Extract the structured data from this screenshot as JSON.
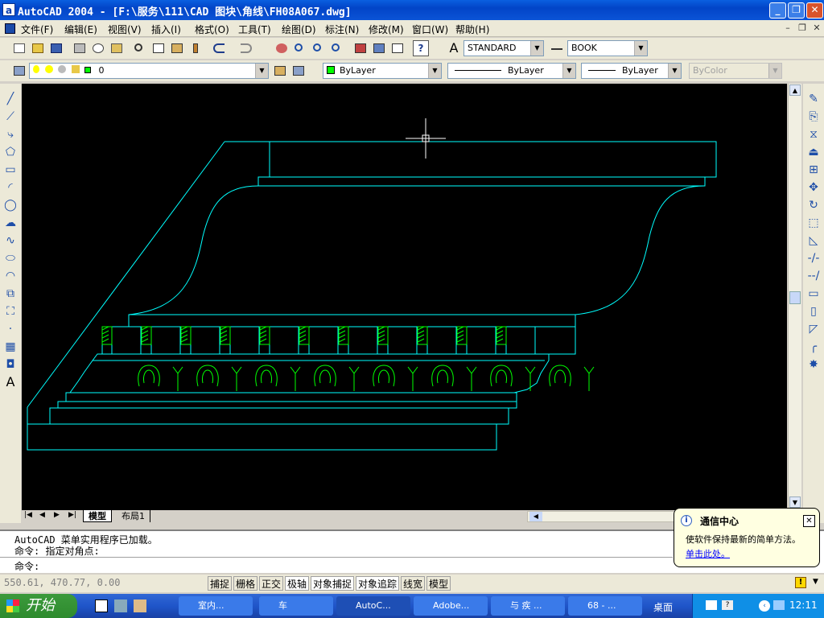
{
  "window": {
    "title": "AutoCAD 2004 - [F:\\服务\\111\\CAD 图块\\角线\\FH08A067.dwg]",
    "app_icon_letter": "a",
    "minimize_glyph": "_",
    "restore_glyph": "❐",
    "close_glyph": "✕"
  },
  "menu": {
    "items": [
      "文件(F)",
      "编辑(E)",
      "视图(V)",
      "插入(I)",
      "格式(O)",
      "工具(T)",
      "绘图(D)",
      "标注(N)",
      "修改(M)",
      "窗口(W)",
      "帮助(H)"
    ],
    "mdi_min": "–",
    "mdi_restore": "❐",
    "mdi_close": "✕"
  },
  "standard_toolbar": {
    "text_style": "STANDARD",
    "dim_style": "BOOK",
    "help_glyph": "?"
  },
  "properties_toolbar": {
    "layer": "0",
    "color": "ByLayer",
    "linetype": "ByLayer",
    "lineweight": "ByLayer",
    "plotstyle": "ByColor"
  },
  "left_toolbar": {
    "text_tool": "A"
  },
  "layout_tabs": {
    "model": "模型",
    "layout1": "布局1"
  },
  "command": {
    "line1": "AutoCAD 菜单实用程序已加载。",
    "line2": "命令: 指定对角点:",
    "prompt": "命令:"
  },
  "status": {
    "coords": "550.61, 470.77, 0.00",
    "buttons": [
      "捕捉",
      "栅格",
      "正交",
      "极轴",
      "对象捕捉",
      "对象追踪",
      "线宽",
      "模型"
    ]
  },
  "balloon": {
    "title": "通信中心",
    "body": "使软件保持最新的简单方法。",
    "link": "单击此处。",
    "close": "✕"
  },
  "taskbar": {
    "start": "开始",
    "tasks": [
      "室内...",
      "车",
      "AutoC...",
      "Adobe...",
      "与 疾 ...",
      "68 - ..."
    ],
    "desktop": "桌面",
    "clock": "12:11"
  },
  "colors": {
    "drawing_cyan": "#00ffff",
    "ornament_green": "#00ff00",
    "canvas_bg": "#000000",
    "titlebar_blue": "#0a5fe0"
  }
}
